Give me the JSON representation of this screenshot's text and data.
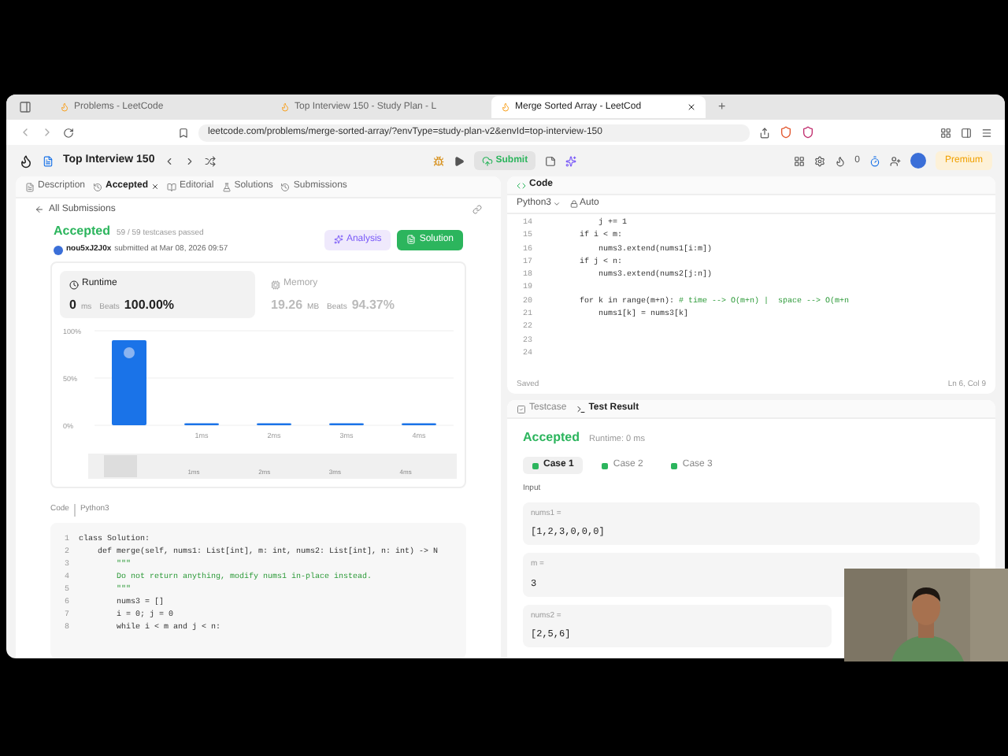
{
  "browser": {
    "tabs": [
      {
        "title": "Problems - LeetCode",
        "selected": false
      },
      {
        "title": "Top Interview 150 - Study Plan - L",
        "selected": false
      },
      {
        "title": "Merge Sorted Array - LeetCod",
        "selected": true
      }
    ],
    "new_tab": "+",
    "url": "leetcode.com/problems/merge-sorted-array/?envType=study-plan-v2&envId=top-interview-150"
  },
  "nav": {
    "title": "Top Interview 150",
    "submit": "Submit",
    "coins": "0",
    "premium": "Premium"
  },
  "left": {
    "tabs": [
      {
        "label": "Description",
        "selected": false
      },
      {
        "label": "Accepted",
        "selected": true
      },
      {
        "label": "Editorial",
        "selected": false
      },
      {
        "label": "Solutions",
        "selected": false
      },
      {
        "label": "Submissions",
        "selected": false
      }
    ],
    "back": "All Submissions",
    "status": "Accepted",
    "testcases": "59 / 59 testcases passed",
    "user": "nou5xJ2J0x",
    "submitted": "submitted at Mar 08, 2026 09:57",
    "analysis": "Analysis",
    "solution": "Solution",
    "stats": [
      {
        "label": "Runtime",
        "value": "0",
        "unit": "ms",
        "beats_label": "Beats",
        "beats": "100.00%",
        "selected": true
      },
      {
        "label": "Memory",
        "value": "19.26",
        "unit": "MB",
        "beats_label": "Beats",
        "beats": "94.37%",
        "selected": false
      }
    ],
    "chart_data": {
      "type": "bar",
      "values": [
        90,
        2,
        2,
        2,
        2
      ],
      "ylim": [
        0,
        100
      ],
      "yticks": [
        {
          "value": 0,
          "label": "0%"
        },
        {
          "value": 50,
          "label": "50%"
        },
        {
          "value": 100,
          "label": "100%"
        }
      ],
      "categories": [
        null,
        "1ms",
        "2ms",
        "3ms",
        "4ms"
      ]
    },
    "navigator_labels": [
      "1ms",
      "2ms",
      "3ms",
      "4ms"
    ],
    "code_label": "Code",
    "language": "Python3",
    "code": [
      {
        "number": "1",
        "code": "class Solution:"
      },
      {
        "number": "2",
        "code": "    def merge(self, nums1: List[int], m: int, nums2: List[int], n: int) -> N"
      },
      {
        "number": "3",
        "comment": "        \"\"\""
      },
      {
        "number": "4",
        "comment": "        Do not return anything, modify nums1 in-place instead."
      },
      {
        "number": "5",
        "comment": "        \"\"\""
      },
      {
        "number": "6",
        "code": "        nums3 = []"
      },
      {
        "number": "7",
        "code": "        i = 0; j = 0"
      },
      {
        "number": "8",
        "code": "        while i < m and j < n:"
      }
    ]
  },
  "right": {
    "title": "Code",
    "language": "Python3",
    "mode": "Auto",
    "lines": [
      {
        "number": "14",
        "code": "            j += 1"
      },
      {
        "number": "15",
        "code": "        if i < m:"
      },
      {
        "number": "16",
        "code": "            nums3.extend(nums1[i:m])"
      },
      {
        "number": "17",
        "code": "        if j < n:"
      },
      {
        "number": "18",
        "code": "            nums3.extend(nums2[j:n])"
      },
      {
        "number": "19"
      },
      {
        "number": "20",
        "code": "        for k in range(m+n): ",
        "comment": "# time --> O(m+n) |  space --> O(m+n"
      },
      {
        "number": "21",
        "code": "            nums1[k] = nums3[k]"
      },
      {
        "number": "22"
      },
      {
        "number": "23"
      },
      {
        "number": "24"
      }
    ],
    "saved": "Saved",
    "cursor": "Ln 6, Col 9",
    "bottom_tabs": [
      {
        "label": "Testcase",
        "selected": false
      },
      {
        "label": "Test Result",
        "selected": true
      }
    ],
    "result": "Accepted",
    "runtime": "Runtime: 0 ms",
    "cases": [
      {
        "label": "Case 1",
        "selected": true
      },
      {
        "label": "Case 2",
        "selected": false
      },
      {
        "label": "Case 3",
        "selected": false
      }
    ],
    "input_label": "Input",
    "inputs": [
      {
        "name": "nums1 =",
        "value": "[1,2,3,0,0,0]"
      },
      {
        "name": "m =",
        "value": "3"
      },
      {
        "name": "nums2 =",
        "value": "[2,5,6]"
      }
    ]
  }
}
